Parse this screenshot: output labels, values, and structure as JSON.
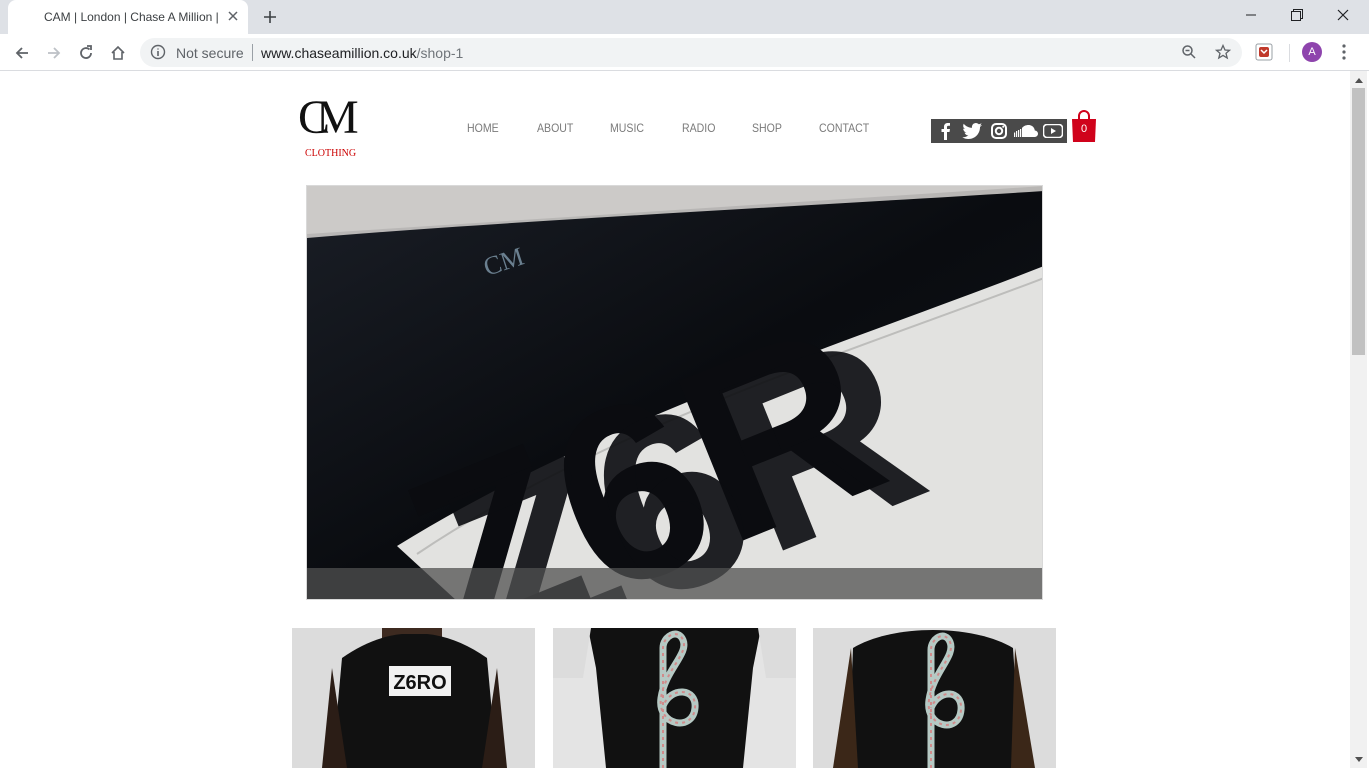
{
  "browser": {
    "tab_title": "CAM | London | Chase A Million |",
    "security_label": "Not secure",
    "url_host": "www.chaseamillion.co.uk",
    "url_path": "/shop-1",
    "profile_initial": "A"
  },
  "site": {
    "logo_letters": "CM",
    "logo_sub": "CLOTHING",
    "nav": [
      "HOME",
      "ABOUT",
      "MUSIC",
      "RADIO",
      "SHOP",
      "CONTACT"
    ],
    "social_icons": [
      "facebook-icon",
      "twitter-icon",
      "instagram-icon",
      "soundcloud-icon",
      "youtube-icon"
    ],
    "cart_count": "0",
    "hero_text": "Z6R",
    "hero_logo_text": "CM",
    "products": [
      {
        "print": "Z6RO"
      },
      {
        "print": "treble-clef"
      },
      {
        "print": "treble-clef"
      }
    ]
  },
  "colors": {
    "accent_red": "#d0021b",
    "nav_text": "#7a7a7a",
    "social_bar": "#4a4a4a"
  }
}
